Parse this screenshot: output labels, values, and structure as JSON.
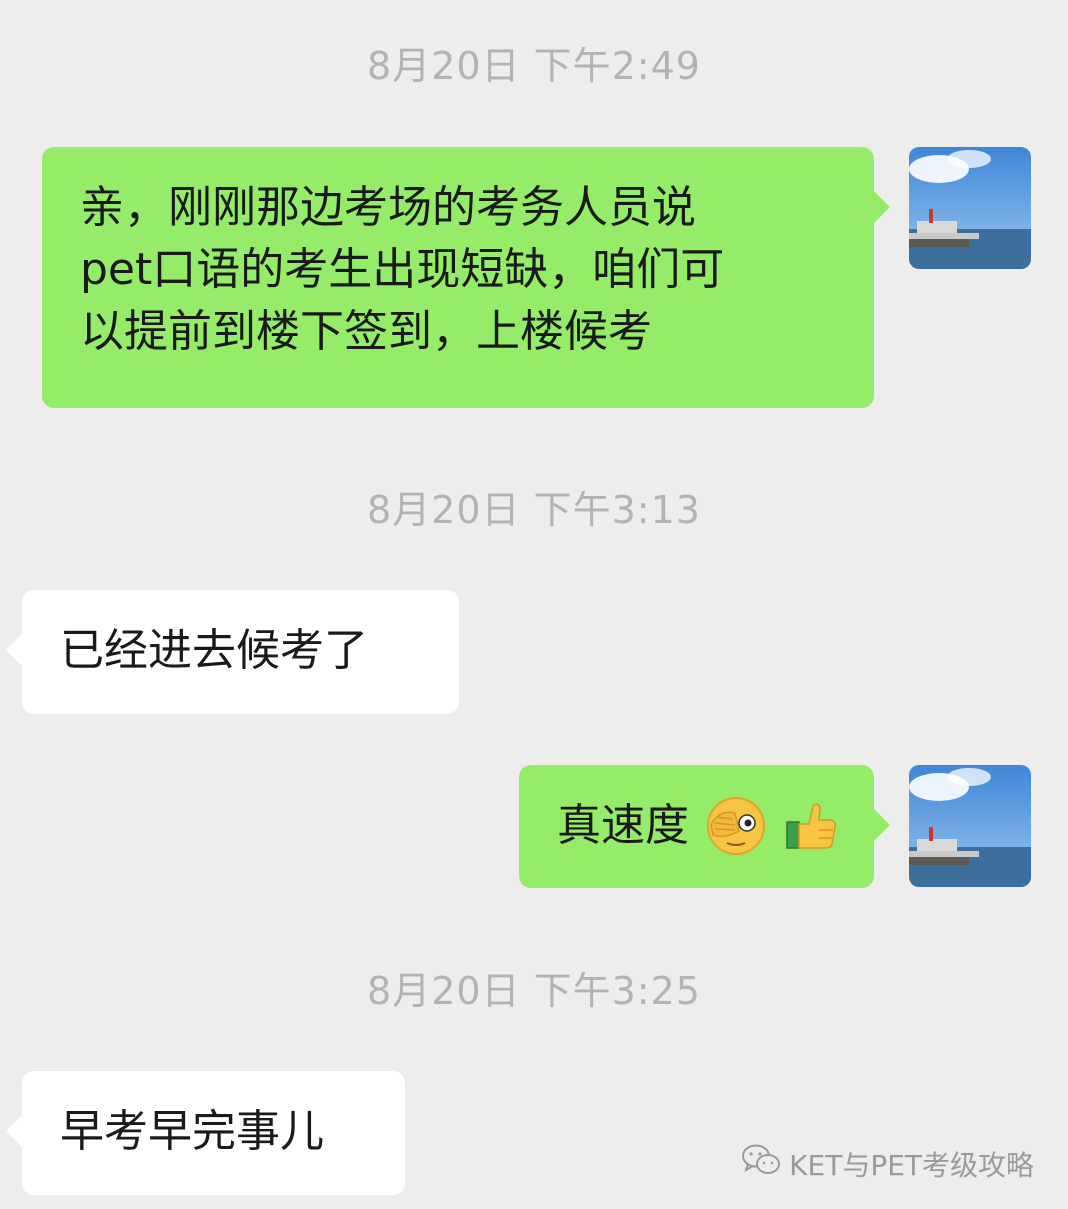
{
  "messages": [
    {
      "timestamp": "8月20日 下午2:49",
      "side": "sent",
      "text": "亲，刚刚那边考场的考务人员说\npet口语的考生出现短缺，咱们可\n以提前到楼下签到，上楼候考"
    },
    {
      "timestamp": "8月20日 下午3:13",
      "side": "received",
      "text": "已经进去候考了"
    },
    {
      "side": "sent",
      "text": "真速度",
      "emojis": [
        "covering-face-peek-icon",
        "thumbs-up-icon"
      ]
    },
    {
      "timestamp": "8月20日 下午3:25",
      "side": "received",
      "text": "早考早完事儿"
    }
  ],
  "watermark": {
    "icon": "wechat-logo-icon",
    "text": "KET与PET考级攻略"
  },
  "colors": {
    "background": "#ededed",
    "sent_bubble": "#95ec69",
    "received_bubble": "#ffffff",
    "timestamp_text": "#b3b3b3"
  }
}
